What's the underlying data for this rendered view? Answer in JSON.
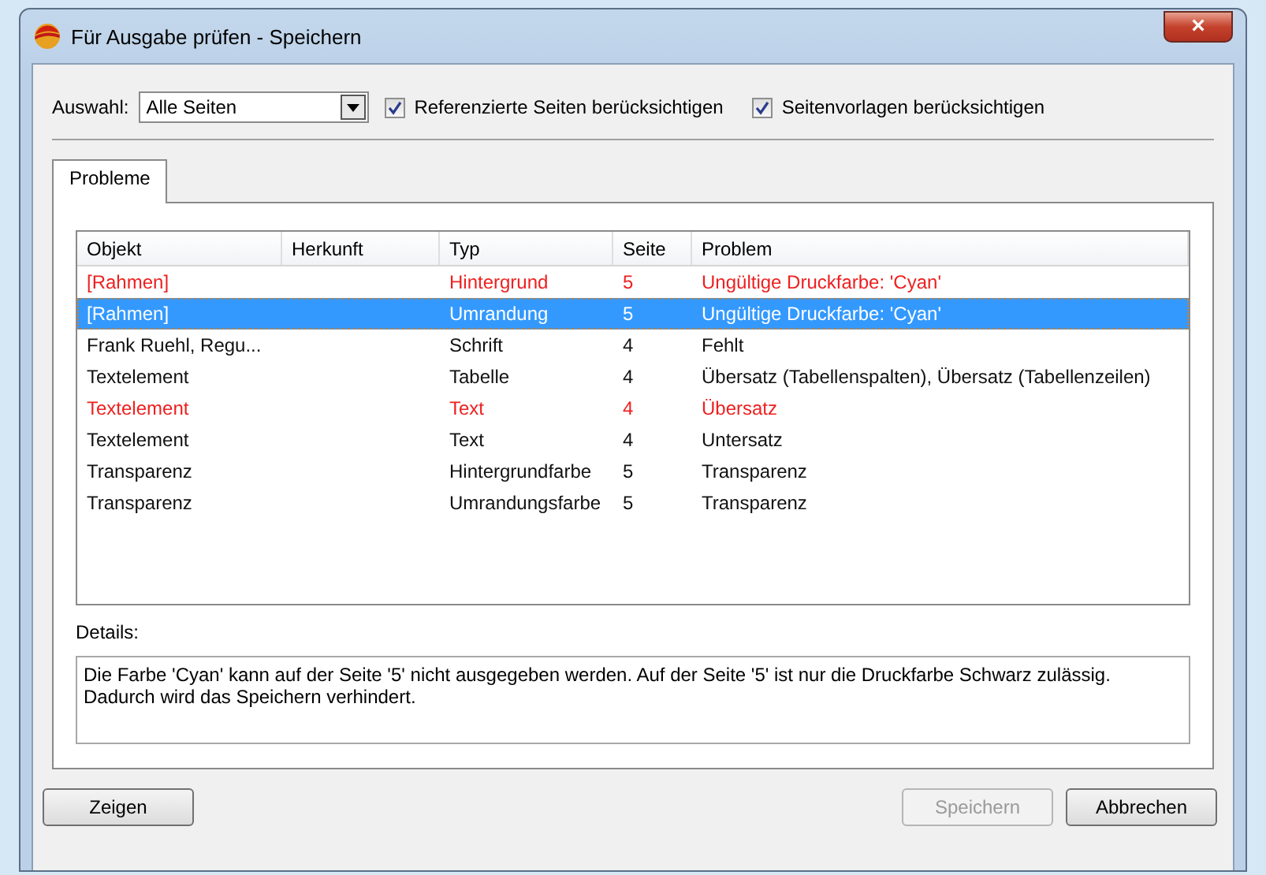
{
  "window": {
    "title": "Für Ausgabe prüfen - Speichern",
    "close": "×"
  },
  "toolbar": {
    "selection_label": "Auswahl:",
    "selection_value": "Alle Seiten",
    "options": [
      {
        "label": "Referenzierte Seiten berücksichtigen",
        "checked": true
      },
      {
        "label": "Seitenvorlagen berücksichtigen",
        "checked": true
      }
    ]
  },
  "tabs": [
    {
      "label": "Probleme",
      "selected": true
    }
  ],
  "table": {
    "columns": [
      "Objekt",
      "Herkunft",
      "Typ",
      "Seite",
      "Problem"
    ],
    "rows": [
      {
        "cells": [
          "[Rahmen]",
          "",
          "Hintergrund",
          "5",
          "Ungültige Druckfarbe: 'Cyan'"
        ],
        "error": true,
        "selected": false
      },
      {
        "cells": [
          "[Rahmen]",
          "",
          "Umrandung",
          "5",
          "Ungültige Druckfarbe: 'Cyan'"
        ],
        "error": true,
        "selected": true
      },
      {
        "cells": [
          "Frank Ruehl, Regu...",
          "",
          "Schrift",
          "4",
          "Fehlt"
        ],
        "error": false,
        "selected": false
      },
      {
        "cells": [
          "Textelement",
          "",
          "Tabelle",
          "4",
          "Übersatz (Tabellenspalten), Übersatz (Tabellenzeilen)"
        ],
        "error": false,
        "selected": false
      },
      {
        "cells": [
          "Textelement",
          "",
          "Text",
          "4",
          "Übersatz"
        ],
        "error": true,
        "selected": false
      },
      {
        "cells": [
          "Textelement",
          "",
          "Text",
          "4",
          "Untersatz"
        ],
        "error": false,
        "selected": false
      },
      {
        "cells": [
          "Transparenz",
          "",
          "Hintergrundfarbe",
          "5",
          "Transparenz"
        ],
        "error": false,
        "selected": false
      },
      {
        "cells": [
          "Transparenz",
          "",
          "Umrandungsfarbe",
          "5",
          "Transparenz"
        ],
        "error": false,
        "selected": false
      }
    ]
  },
  "details": {
    "label": "Details:",
    "lines": [
      "Die Farbe 'Cyan' kann auf der Seite '5' nicht ausgegeben werden. Auf der Seite '5' ist nur die Druckfarbe Schwarz zulässig.",
      "Dadurch wird das Speichern verhindert."
    ]
  },
  "buttons": [
    {
      "label": "Zeigen",
      "disabled": false,
      "kind": "left"
    },
    {
      "label": "Speichern",
      "disabled": true,
      "kind": "right"
    },
    {
      "label": "Abbrechen",
      "disabled": false,
      "kind": "right"
    }
  ]
}
